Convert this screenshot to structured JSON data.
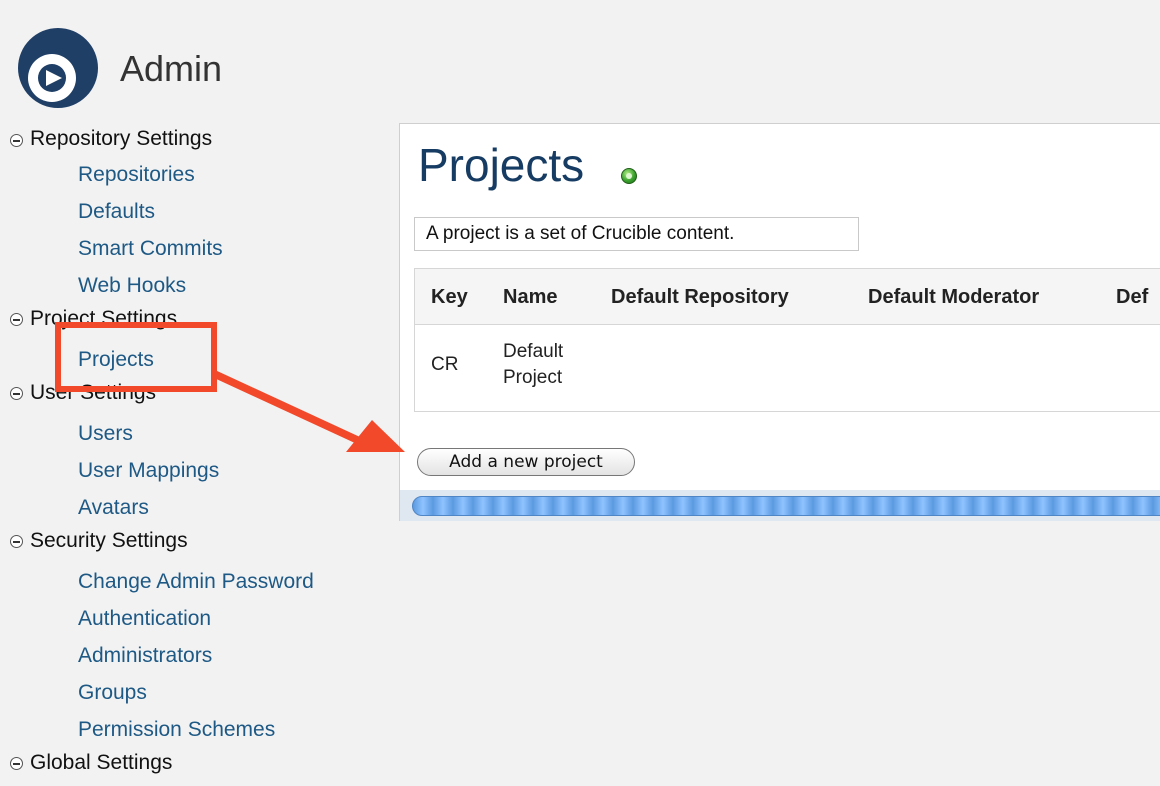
{
  "app": {
    "title": "Admin",
    "logo_icon": "crucible-logo-icon"
  },
  "sidebar": {
    "sections": [
      {
        "label": "Repository Settings",
        "items": [
          "Repositories",
          "Defaults",
          "Smart Commits",
          "Web Hooks"
        ]
      },
      {
        "label": "Project Settings",
        "items": [
          "Projects"
        ]
      },
      {
        "label": "User Settings",
        "items": [
          "Users",
          "User Mappings",
          "Avatars"
        ]
      },
      {
        "label": "Security Settings",
        "items": [
          "Change Admin Password",
          "Authentication",
          "Administrators",
          "Groups",
          "Permission Schemes"
        ]
      },
      {
        "label": "Global Settings",
        "items": []
      }
    ]
  },
  "main": {
    "title": "Projects",
    "help_icon": "help-icon",
    "description": "A project is a set of Crucible content.",
    "table": {
      "headers": [
        "Key",
        "Name",
        "Default Repository",
        "Default Moderator",
        "Def"
      ],
      "rows": [
        {
          "key": "CR",
          "name_line1": "Default",
          "name_line2": "Project"
        }
      ]
    },
    "add_button": "Add a new project"
  },
  "annotations": {
    "highlight_color": "#f2492b",
    "arrow_color": "#f2492b"
  },
  "colors": {
    "link": "#1e5985",
    "title": "#173c63"
  }
}
